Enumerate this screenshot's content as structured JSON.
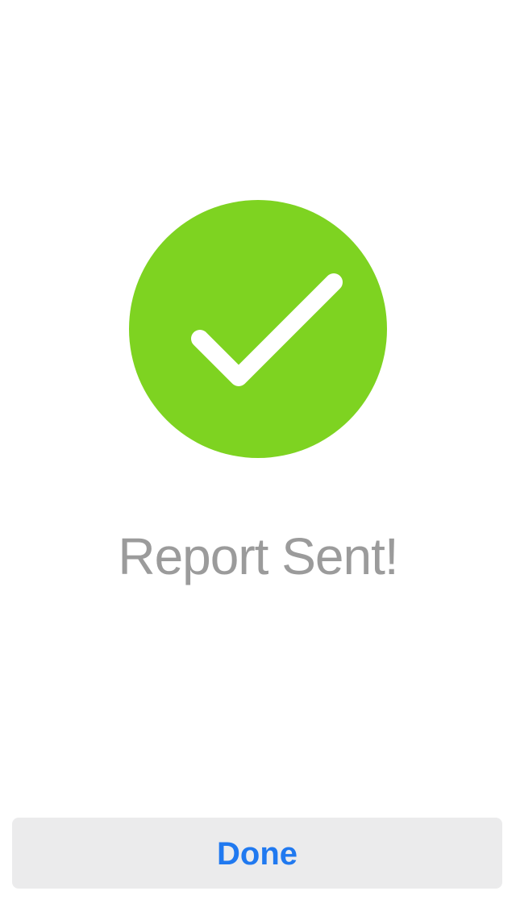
{
  "status": {
    "icon": "checkmark-icon",
    "title": "Report Sent!"
  },
  "actions": {
    "done_label": "Done"
  },
  "colors": {
    "success": "#7ED321",
    "title_text": "#9B9B9B",
    "button_background": "#EBEBEC",
    "button_text": "#2079F0"
  }
}
